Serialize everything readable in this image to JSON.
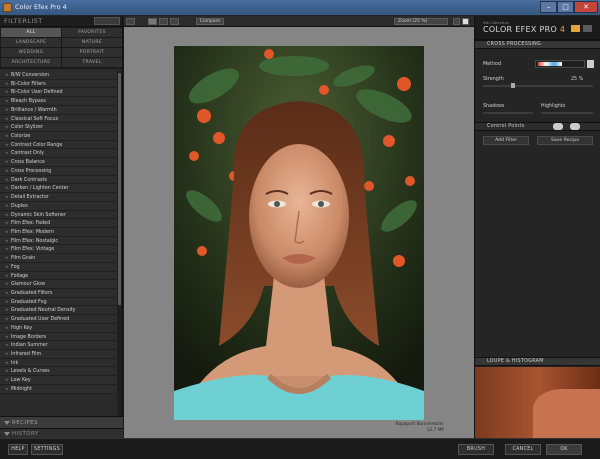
{
  "window": {
    "title": "Color Efex Pro 4"
  },
  "left_panel": {
    "header": "FILTERLIST",
    "categories": [
      "ALL",
      "FAVORITES",
      "LANDSCAPE",
      "NATURE",
      "WEDDING",
      "PORTRAIT",
      "ARCHITECTURE",
      "TRAVEL"
    ],
    "active_category": "ALL",
    "filters": [
      "B/W Conversion",
      "Bi-Color Filters",
      "Bi-Color User Defined",
      "Bleach Bypass",
      "Brilliance / Warmth",
      "Classical Soft Focus",
      "Color Stylizer",
      "Colorize",
      "Contrast Color Range",
      "Contrast Only",
      "Cross Balance",
      "Cross Processing",
      "Dark Contrasts",
      "Darken / Lighten Center",
      "Detail Extractor",
      "Duplex",
      "Dynamic Skin Softener",
      "Film Efex: Faded",
      "Film Efex: Modern",
      "Film Efex: Nostalgic",
      "Film Efex: Vintage",
      "Film Grain",
      "Fog",
      "Foliage",
      "Glamour Glow",
      "Graduated Filters",
      "Graduated Fog",
      "Graduated Neutral Density",
      "Graduated User Defined",
      "High Key",
      "Image Borders",
      "Indian Summer",
      "Infrared Film",
      "Ink",
      "Levels & Curves",
      "Low Key",
      "Midnight"
    ],
    "recipes_label": "RECIPES",
    "history_label": "HISTORY"
  },
  "center": {
    "compare_label": "Compare",
    "zoom_label": "Zoom (25 %)",
    "caption_line1": "Rapaport Bannmetzler",
    "caption_line2": "12.7 MP"
  },
  "right_panel": {
    "brand_sub": "Nik Collection",
    "brand_name": "COLOR EFEX PRO",
    "brand_version": "4",
    "section_title": "CROSS PROCESSING",
    "method_label": "Method",
    "strength_label": "Strength",
    "strength_value": "25 %",
    "strength_fraction": 0.25,
    "shadows_label": "Shadows",
    "highlights_label": "Highlights",
    "control_points_label": "Control Points",
    "add_filter_label": "Add Filter",
    "save_recipe_label": "Save Recipe",
    "loupe_label": "LOUPE & HISTOGRAM"
  },
  "bottom": {
    "help_label": "HELP",
    "settings_label": "SETTINGS",
    "brush_label": "BRUSH",
    "cancel_label": "CANCEL",
    "ok_label": "OK"
  }
}
